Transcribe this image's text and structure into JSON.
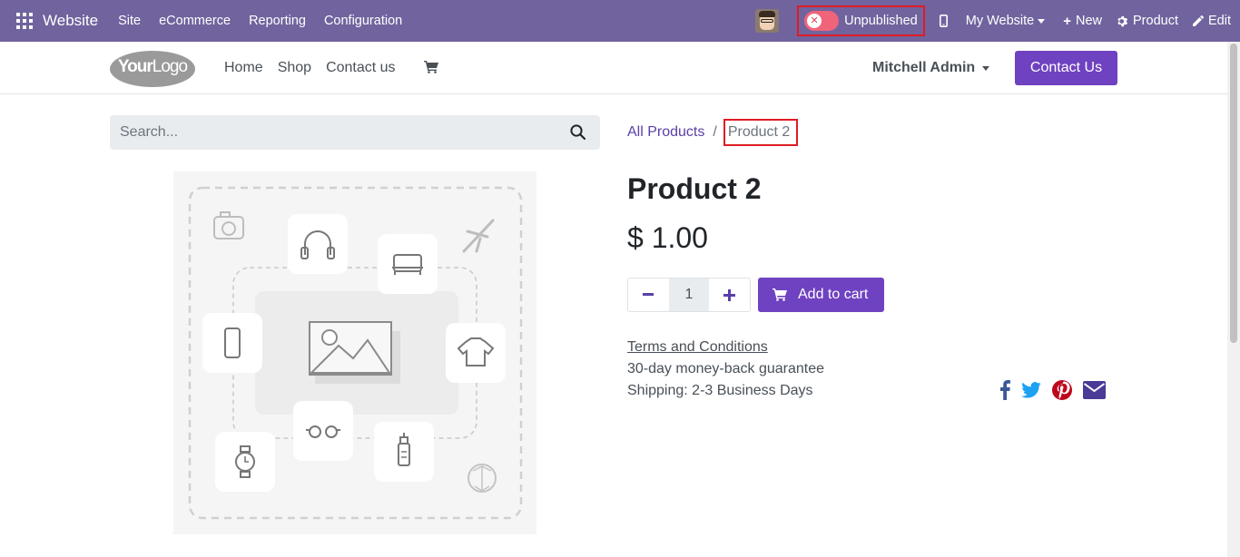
{
  "admin_bar": {
    "app_name": "Website",
    "menu": [
      "Site",
      "eCommerce",
      "Reporting",
      "Configuration"
    ],
    "publish_status": "Unpublished",
    "website_switch": "My Website",
    "new_label": "New",
    "product_label": "Product",
    "edit_label": "Edit"
  },
  "site_header": {
    "logo_text_bold": "Your",
    "logo_text_light": "Logo",
    "nav": [
      "Home",
      "Shop",
      "Contact us"
    ],
    "user_name": "Mitchell Admin",
    "contact_button": "Contact Us"
  },
  "search": {
    "placeholder": "Search..."
  },
  "breadcrumb": {
    "parent": "All Products",
    "separator": "/",
    "current": "Product 2"
  },
  "product": {
    "name": "Product 2",
    "price": "$ 1.00",
    "quantity": "1",
    "add_to_cart": "Add to cart",
    "terms": "Terms and Conditions",
    "guarantee": "30-day money-back guarantee",
    "shipping": "Shipping: 2-3 Business Days"
  },
  "share_icons": [
    "facebook-icon",
    "twitter-icon",
    "pinterest-icon",
    "email-icon"
  ],
  "colors": {
    "admin_bar": "#71639e",
    "primary": "#6f42c1",
    "facebook": "#3b5998",
    "twitter": "#1da1f2",
    "pinterest": "#bd081c",
    "email": "#4b3a96"
  }
}
